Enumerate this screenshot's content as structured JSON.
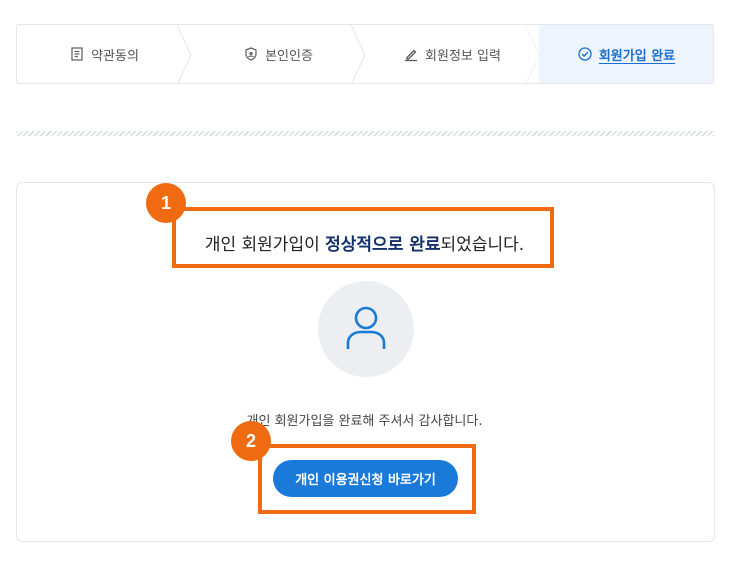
{
  "steps": [
    {
      "label": "약관동의",
      "icon": "document-icon",
      "active": false
    },
    {
      "label": "본인인증",
      "icon": "shield-icon",
      "active": false
    },
    {
      "label": "회원정보 입력",
      "icon": "pencil-icon",
      "active": false
    },
    {
      "label": "회원가입 완료",
      "icon": "check-circle-icon",
      "active": true
    }
  ],
  "result": {
    "headline_prefix": "개인 회원가입이 ",
    "headline_strong": "정상적으로 완료",
    "headline_suffix": "되었습니다.",
    "thanks": "개인 회원가입을 완료해 주셔서 감사합니다.",
    "cta_label": "개인 이용권신청 바로가기"
  },
  "annotations": {
    "badge_1": "1",
    "badge_2": "2"
  },
  "colors": {
    "accent": "#1a7ad9",
    "highlight": "#ef6a10",
    "active_step_bg": "#eef4fb"
  }
}
